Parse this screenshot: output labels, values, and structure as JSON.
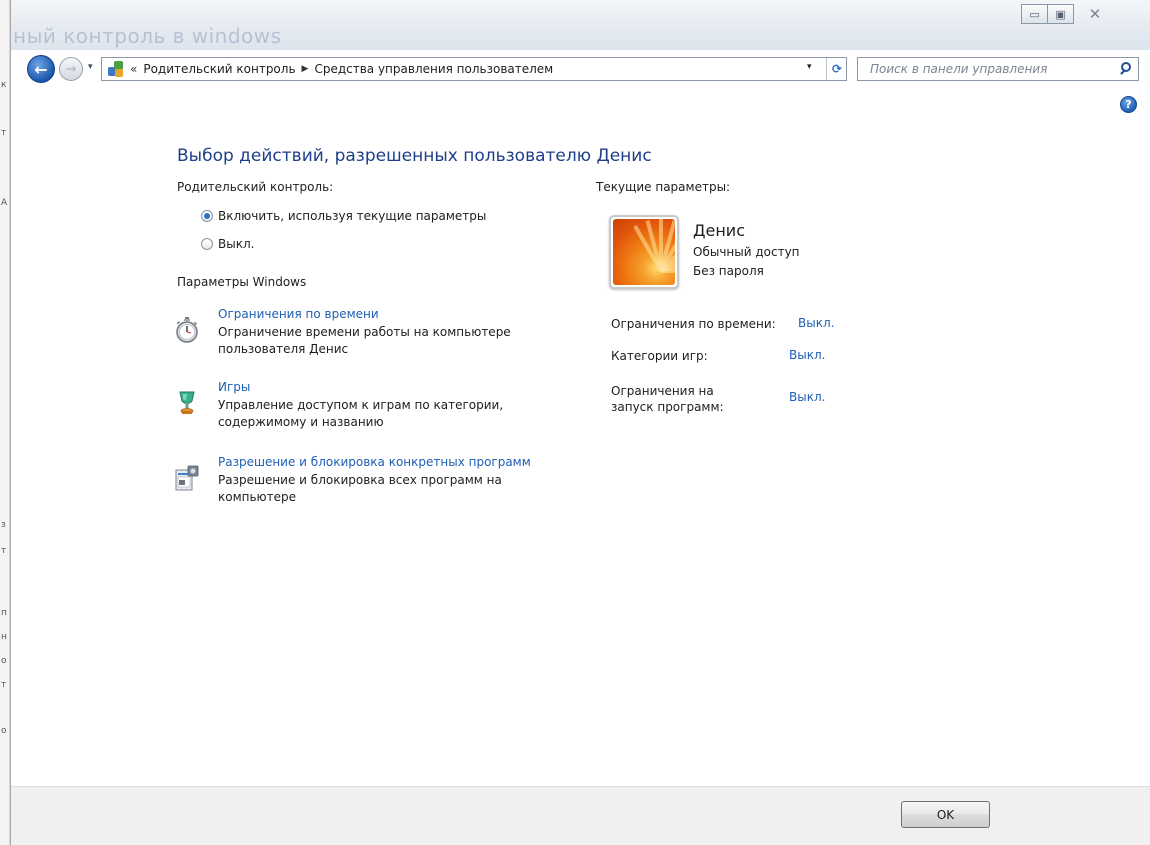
{
  "window": {
    "title": "ный контроль в windows"
  },
  "controls": {
    "minimize": "▭",
    "maximize": "▣",
    "close": "✕"
  },
  "nav": {
    "back": "←",
    "forward": "→",
    "history": "▾"
  },
  "address": {
    "chevrons": "«",
    "breadcrumbs": [
      "Родительский контроль",
      "Средства управления пользователем"
    ],
    "separator": "▶",
    "dropdown": "▾",
    "refresh": "⟳"
  },
  "search": {
    "placeholder": "Поиск в панели управления"
  },
  "help": "?",
  "main": {
    "title": "Выбор действий, разрешенных пользователю Денис",
    "parental_label": "Родительский контроль:",
    "radio_on": "Включить, используя текущие параметры",
    "radio_off": "Выкл.",
    "windows_params_label": "Параметры Windows",
    "tasks": [
      {
        "link": "Ограничения по времени",
        "desc": "Ограничение времени работы на компьютере пользователя Денис",
        "icon": "stopwatch-icon"
      },
      {
        "link": "Игры",
        "desc": "Управление доступом к играм по категории, содержимому и названию",
        "icon": "trophy-icon"
      },
      {
        "link": "Разрешение и блокировка конкретных программ",
        "desc": "Разрешение и блокировка всех программ на компьютере",
        "icon": "program-icon"
      }
    ]
  },
  "current": {
    "label": "Текущие параметры:",
    "user_name": "Денис",
    "access_type": "Обычный доступ",
    "password": "Без пароля",
    "settings": [
      {
        "label": "Ограничения по времени:",
        "value": "Выкл."
      },
      {
        "label": "Категории игр:",
        "value": "Выкл."
      },
      {
        "label": "Ограничения на запуск программ:",
        "value": "Выкл."
      }
    ]
  },
  "footer": {
    "ok_label": "OK"
  }
}
